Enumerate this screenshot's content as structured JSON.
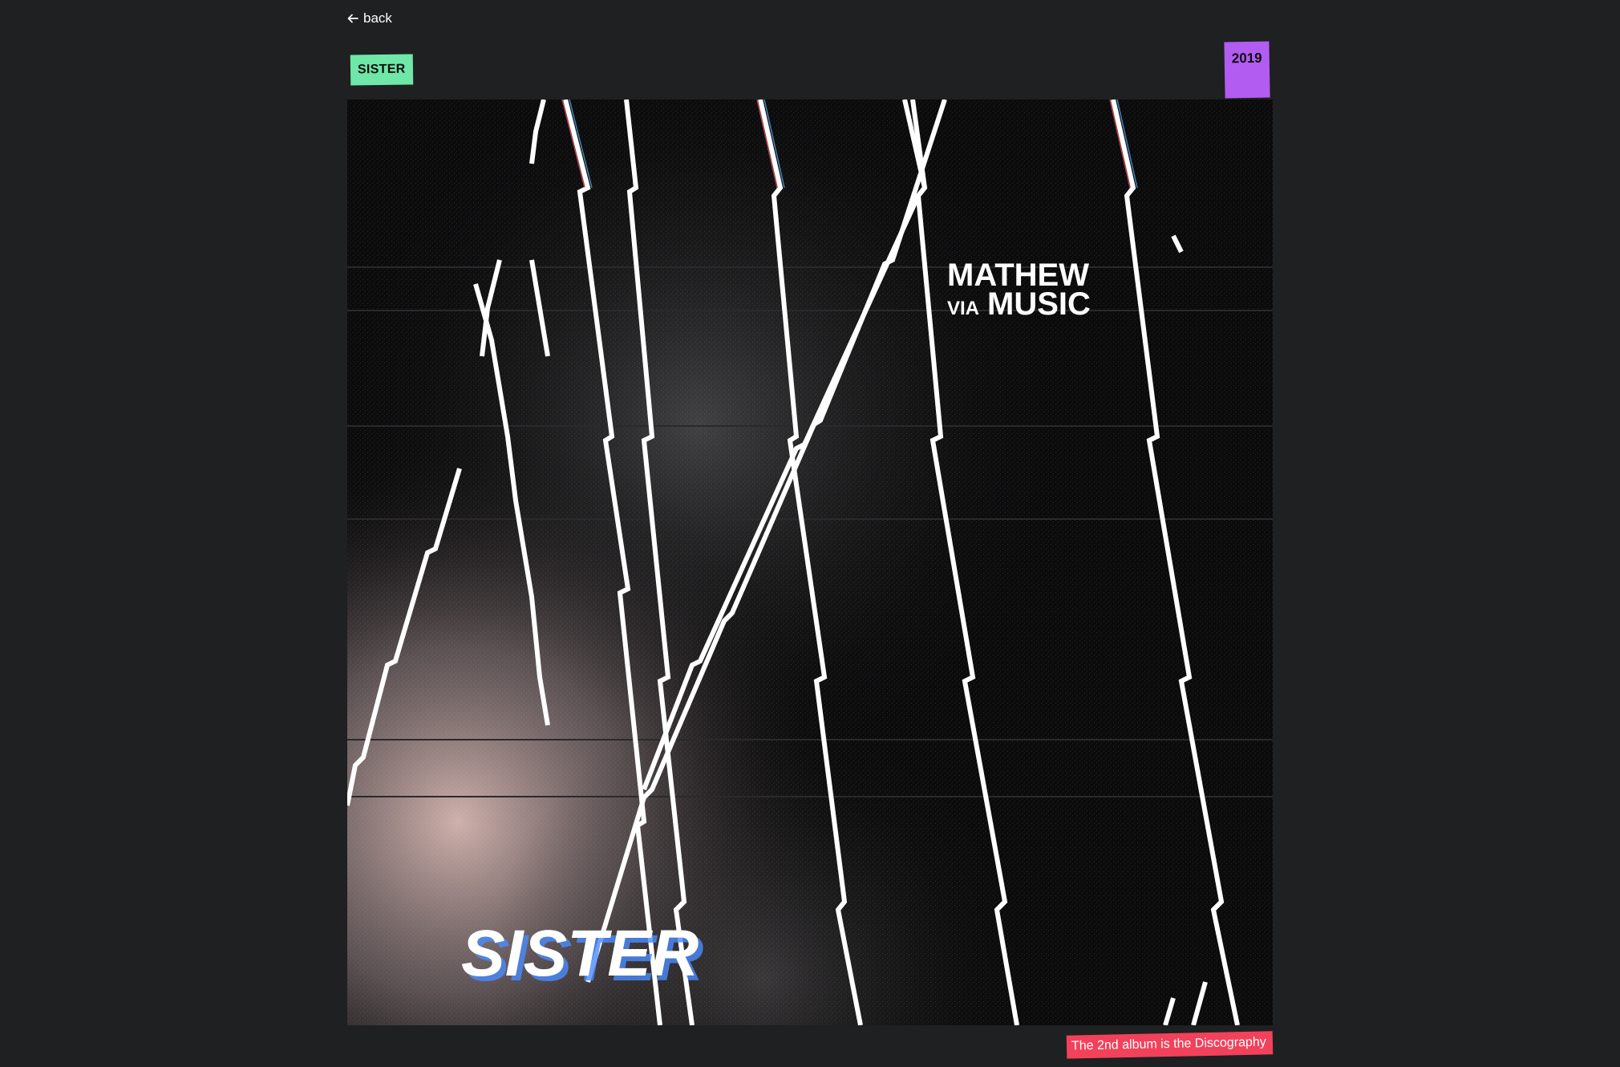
{
  "nav": {
    "back_label": "back",
    "back_icon": "arrow-left-icon"
  },
  "album": {
    "title_tag": "SISTER",
    "year": "2019",
    "caption": "The 2nd album is the Discography"
  },
  "cover": {
    "artist_line_1": "MATHEW",
    "artist_line_2_prefix": "VIA",
    "artist_line_2": "MUSIC",
    "title": "SISTER"
  },
  "colors": {
    "background": "#1f2022",
    "title_tag": "#6ee7a8",
    "year_tag": "#b25cf2",
    "caption_tag": "#f2415a"
  }
}
